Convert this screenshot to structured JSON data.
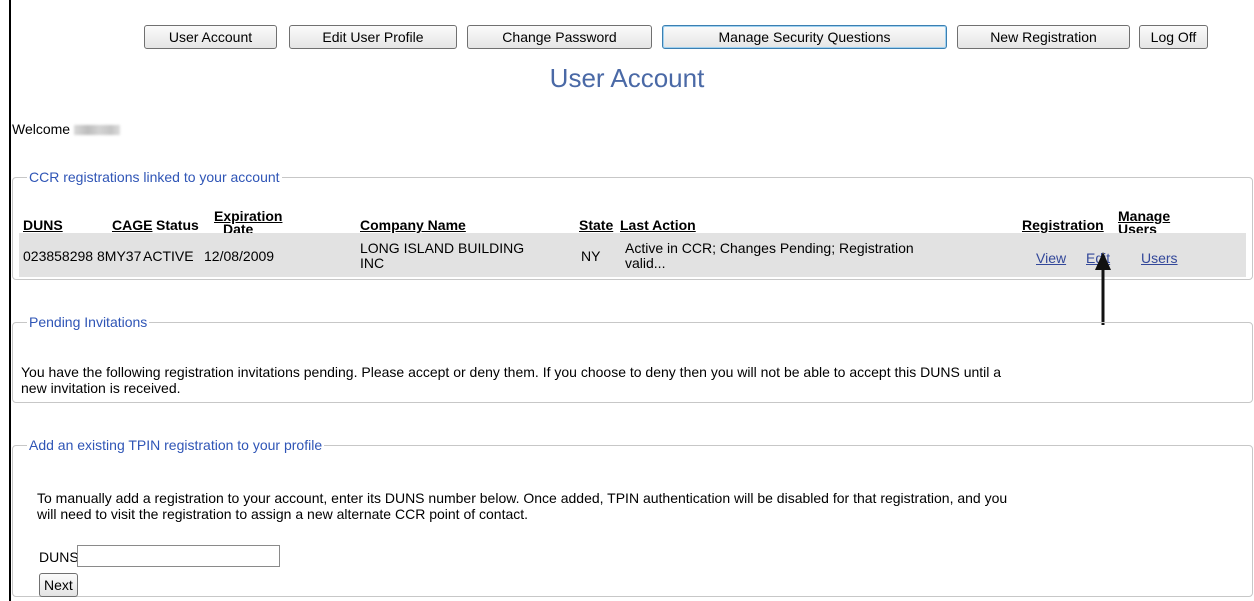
{
  "nav": {
    "buttons": [
      {
        "label": "User Account"
      },
      {
        "label": "Edit User Profile"
      },
      {
        "label": "Change Password"
      },
      {
        "label": "Manage Security Questions"
      },
      {
        "label": "New Registration"
      },
      {
        "label": "Log Off"
      }
    ]
  },
  "page": {
    "title": "User Account",
    "welcome": "Welcome"
  },
  "ccr": {
    "legend": "CCR registrations linked to your account",
    "headers": {
      "duns": "DUNS",
      "cage": "CAGE",
      "status": "Status",
      "expiration_1": "Expiration",
      "expiration_2": "Date",
      "company": "Company Name",
      "state": "State",
      "last_action": "Last Action",
      "registration": "Registration",
      "manage_1": "Manage",
      "manage_2": "Users"
    },
    "rows": [
      {
        "duns": "023858298",
        "cage": "8MY37",
        "status": "ACTIVE",
        "expiration": "12/08/2009",
        "company_1": "LONG ISLAND BUILDING",
        "company_2": "INC",
        "state": "NY",
        "last_action_1": "Active in CCR; Changes Pending; Registration",
        "last_action_2": "valid...",
        "view": "View",
        "edit": "Edit",
        "users": "Users"
      }
    ]
  },
  "pending": {
    "legend": "Pending Invitations",
    "text_1": "You have the following registration invitations pending. Please accept or deny them. If you choose to deny then you will not be able to accept this DUNS until a",
    "text_2": "new invitation is received."
  },
  "tpin": {
    "legend": "Add an existing TPIN registration to your profile",
    "text_1": "To manually add a registration to your account, enter its DUNS number below. Once added, TPIN authentication will be disabled for that registration, and you",
    "text_2": "will need to visit the registration to assign a new alternate CCR point of contact.",
    "duns_label": "DUNS:",
    "duns_value": "",
    "next_label": "Next"
  }
}
